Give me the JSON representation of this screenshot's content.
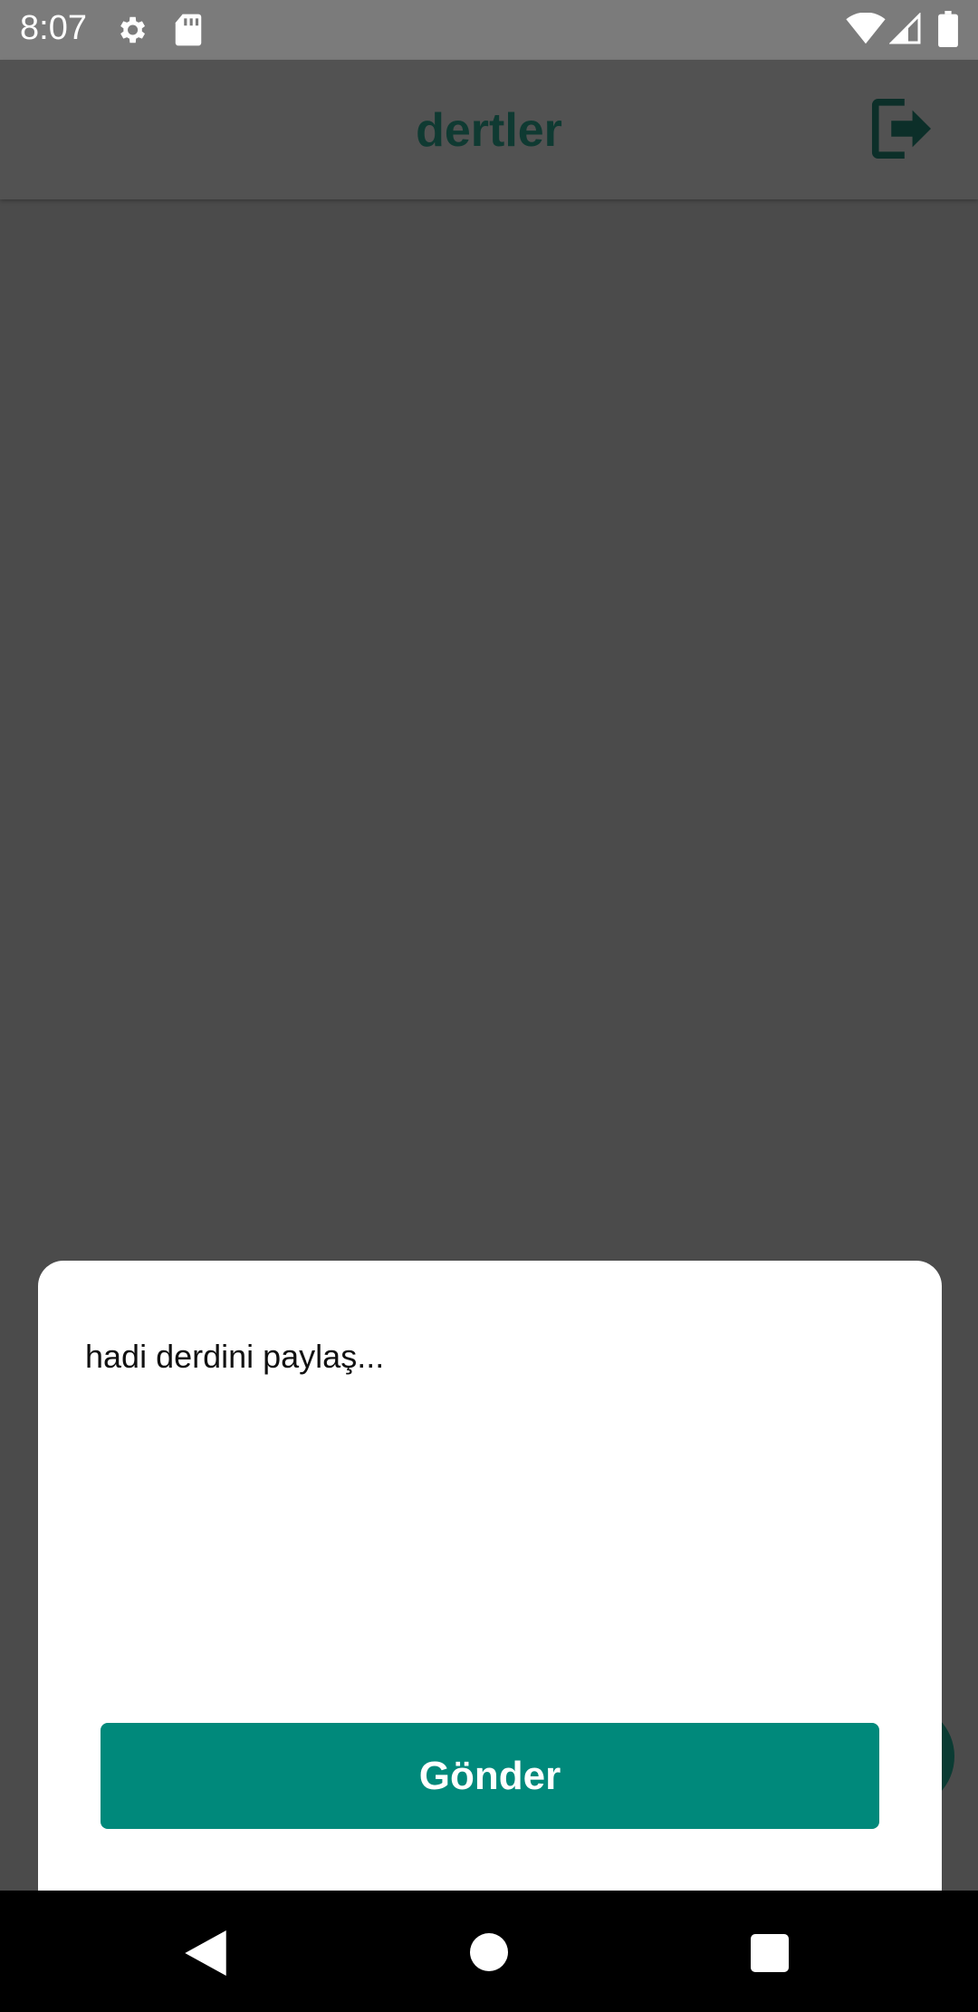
{
  "status_bar": {
    "time": "8:07",
    "icons": [
      "gear-icon",
      "sd-card-icon",
      "wifi-icon",
      "signal-icon",
      "battery-icon"
    ]
  },
  "app_bar": {
    "title": "dertler",
    "action_icon": "logout-icon",
    "title_color": "#0f3a32"
  },
  "sheet": {
    "input_placeholder": "hadi derdini paylaş...",
    "send_label": "Gönder",
    "accent_color": "#00897b"
  },
  "nav_bar": {
    "icons": [
      "back-icon",
      "home-icon",
      "recents-icon"
    ]
  }
}
